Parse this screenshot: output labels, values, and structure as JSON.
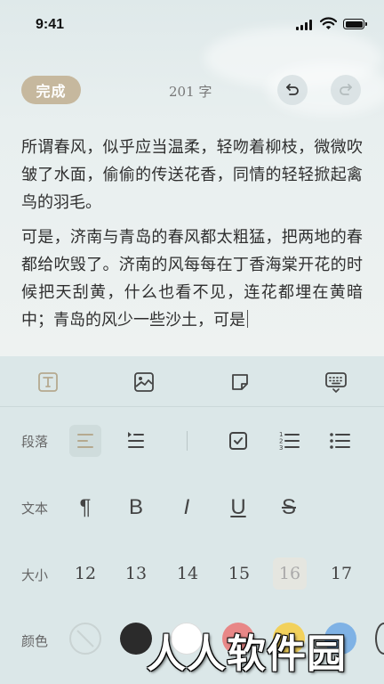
{
  "status_bar": {
    "time": "9:41"
  },
  "toolbar": {
    "done_label": "完成",
    "word_count": "201 字"
  },
  "editor": {
    "paragraphs": [
      "所谓春风，似乎应当温柔，轻吻着柳枝，微微吹皱了水面，偷偷的传送花香，同情的轻轻掀起禽鸟的羽毛。",
      "可是，济南与青岛的春风都太粗猛，把两地的春都给吹毁了。济南的风每每在丁香海棠开花的时候把天刮黄，什么也看不见，连花都埋在黄暗中；青岛的风少一些沙土，可是"
    ]
  },
  "format_panel": {
    "paragraph_label": "段落",
    "text_label": "文本",
    "size_label": "大小",
    "color_label": "颜色",
    "sizes": [
      "12",
      "13",
      "14",
      "15",
      "16",
      "17"
    ],
    "selected_size": "16",
    "swatches": [
      "none",
      "#2b2b2b",
      "#ffffff",
      "#e88787",
      "#f2d15c",
      "#7fb2e5"
    ]
  },
  "watermark": "人人软件园",
  "colors": {
    "accent": "#c6b89e",
    "panel": "#dbe7e8"
  }
}
